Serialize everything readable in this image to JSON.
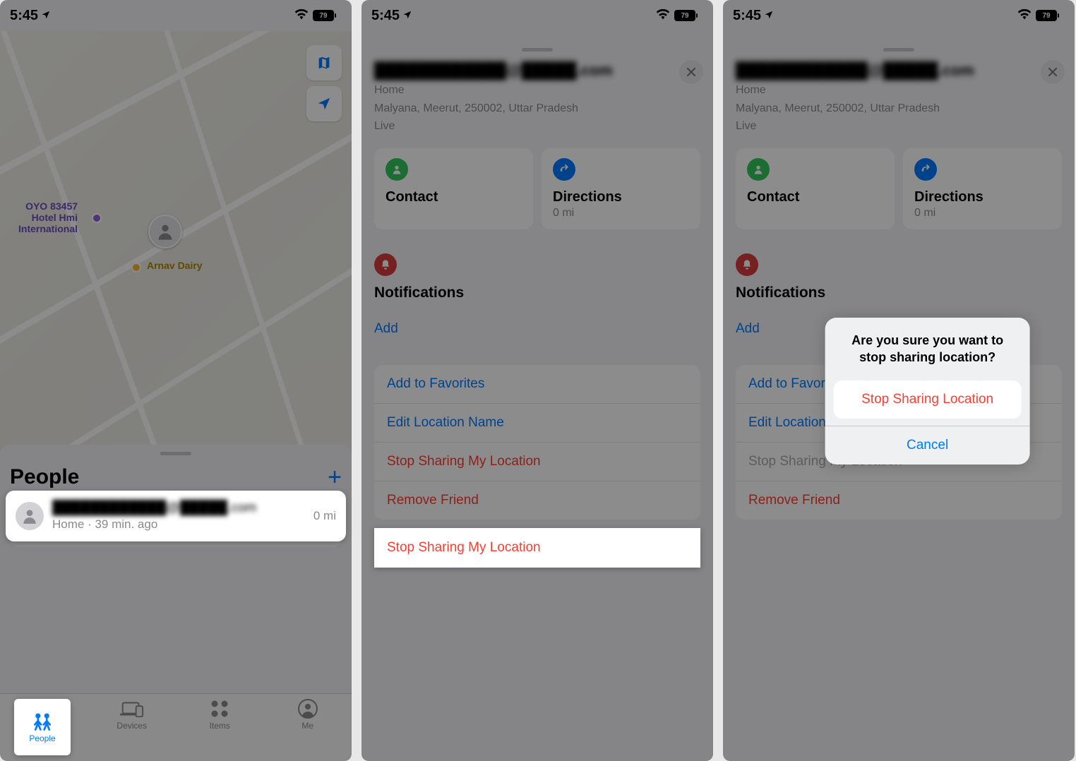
{
  "status": {
    "time": "5:45",
    "battery": "79"
  },
  "screen1": {
    "people_title": "People",
    "map_labels": {
      "hotel1": "OYO 83457",
      "hotel2": "Hotel Hmi",
      "hotel3": "International",
      "dairy": "Arnav Dairy"
    },
    "person": {
      "name_obscured": "████████████@█████.com",
      "meta": "Home · 39 min. ago",
      "distance": "0 mi"
    },
    "tabs": {
      "people": "People",
      "devices": "Devices",
      "items": "Items",
      "me": "Me"
    }
  },
  "sheet": {
    "title_obscured": "████████████@█████.com",
    "sub_line1": "Home",
    "sub_line2": "Malyana, Meerut, 250002, Uttar Pradesh",
    "sub_line3": "Live",
    "contact": "Contact",
    "directions": "Directions",
    "directions_sub": "0 mi",
    "notifications": "Notifications",
    "add": "Add",
    "add_fav": "Add to Favorites",
    "edit_loc": "Edit Location Name",
    "stop_share": "Stop Sharing My Location",
    "remove": "Remove Friend"
  },
  "alert": {
    "msg": "Are you sure you want to stop sharing location?",
    "stop": "Stop Sharing Location",
    "cancel": "Cancel"
  }
}
